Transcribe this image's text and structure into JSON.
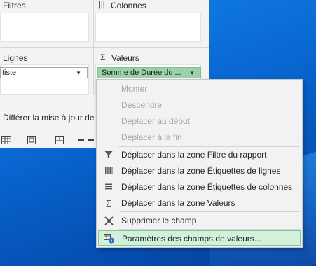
{
  "panel": {
    "filters_label": "Filtres",
    "columns_label": "Colonnes",
    "rows_label": "Lignes",
    "values_label": "Valeurs",
    "row_field": "tiste",
    "value_field": "Somme de Durée du ...",
    "defer_label": "Différer la mise à jour de l",
    "icons": {
      "columns": "columns-icon",
      "values": "sigma-icon"
    }
  },
  "menu": {
    "items": [
      {
        "label": "Monter",
        "enabled": false
      },
      {
        "label": "Descendre",
        "enabled": false
      },
      {
        "label": "Déplacer au début",
        "enabled": false
      },
      {
        "label": "Déplacer à la fin",
        "enabled": false
      },
      {
        "label": "Déplacer dans la zone Filtre du rapport",
        "enabled": true,
        "icon": "filter-icon"
      },
      {
        "label": "Déplacer dans la zone Étiquettes de lignes",
        "enabled": true,
        "icon": "rows-icon"
      },
      {
        "label": "Déplacer dans la zone Étiquettes de colonnes",
        "enabled": true,
        "icon": "columns-icon"
      },
      {
        "label": "Déplacer dans la zone Valeurs",
        "enabled": true,
        "icon": "sigma-icon"
      },
      {
        "label": "Supprimer le champ",
        "enabled": true,
        "icon": "remove-icon"
      },
      {
        "label": "Paramètres des champs de valeurs...",
        "enabled": true,
        "icon": "field-settings-icon",
        "highlighted": true
      }
    ]
  },
  "colors": {
    "chip": "#9bd2a9",
    "highlight": "#d3f0dc",
    "disabled_text": "#a6a6a6",
    "desktop": "#0b6cd8"
  }
}
